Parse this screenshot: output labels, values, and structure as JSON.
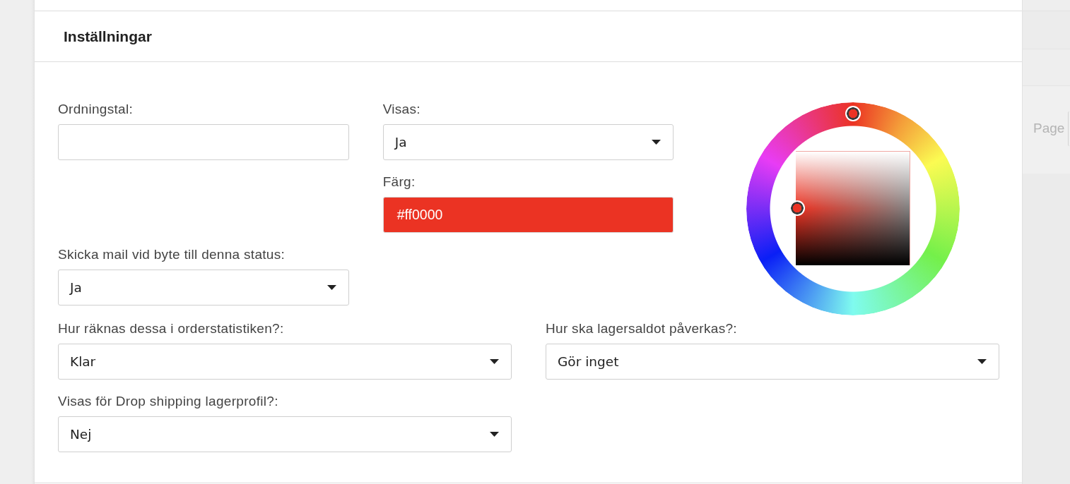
{
  "background_page": {
    "pager_label": "Page"
  },
  "panel": {
    "title": "Inställningar"
  },
  "form": {
    "column_1": [
      {
        "kind": "text",
        "label": "Ordningstal:"
      },
      {
        "kind": "select",
        "label": "Skicka mail vid byte till denna status:",
        "value": "Ja"
      }
    ],
    "column_2": [
      {
        "kind": "select",
        "label": "Visas:",
        "value": "Ja"
      },
      {
        "kind": "color",
        "label": "Färg:",
        "value": "#ff0000"
      }
    ],
    "rows": [
      {
        "kind": "select",
        "label": "Hur räknas dessa i orderstatistiken?:",
        "value": "Klar"
      },
      {
        "kind": "select",
        "label": "Hur ska lagersaldot påverkas?:",
        "value": "Gör inget"
      },
      {
        "kind": "select",
        "label": "Visas för Drop shipping lagerprofil?:",
        "value": "Nej"
      }
    ]
  }
}
